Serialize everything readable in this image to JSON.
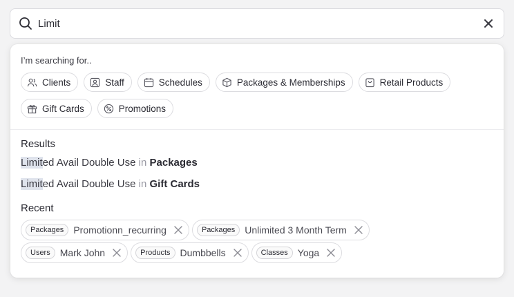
{
  "search": {
    "value": "Limit"
  },
  "filters": {
    "hint": "I’m searching for..",
    "row1": [
      {
        "label": "Clients",
        "icon": "users-icon"
      },
      {
        "label": "Staff",
        "icon": "staff-badge-icon"
      },
      {
        "label": "Schedules",
        "icon": "calendar-icon"
      },
      {
        "label": "Packages & Memberships",
        "icon": "package-box-icon"
      },
      {
        "label": "Retail Products",
        "icon": "shopping-bag-icon"
      }
    ],
    "row2": [
      {
        "label": "Gift Cards",
        "icon": "gift-icon"
      },
      {
        "label": "Promotions",
        "icon": "percent-badge-icon"
      }
    ]
  },
  "results": {
    "heading": "Results",
    "items": [
      {
        "match": "Limit",
        "rest": "ed Avail Double Use",
        "connector": "in",
        "category": "Packages"
      },
      {
        "match": "Limit",
        "rest": "ed Avail Double Use",
        "connector": "in",
        "category": "Gift Cards"
      }
    ]
  },
  "recent": {
    "heading": "Recent",
    "row1": [
      {
        "tag": "Packages",
        "label": "Promotionn_recurring"
      },
      {
        "tag": "Packages",
        "label": "Unlimited 3 Month Term"
      }
    ],
    "row2": [
      {
        "tag": "Users",
        "label": "Mark John"
      },
      {
        "tag": "Products",
        "label": "Dumbbells"
      },
      {
        "tag": "Classes",
        "label": "Yoga"
      }
    ]
  },
  "colors": {
    "highlight": "#dfe3ec",
    "border": "#dcdce0",
    "text": "#2b2b33",
    "muted": "#9a9aa4"
  }
}
